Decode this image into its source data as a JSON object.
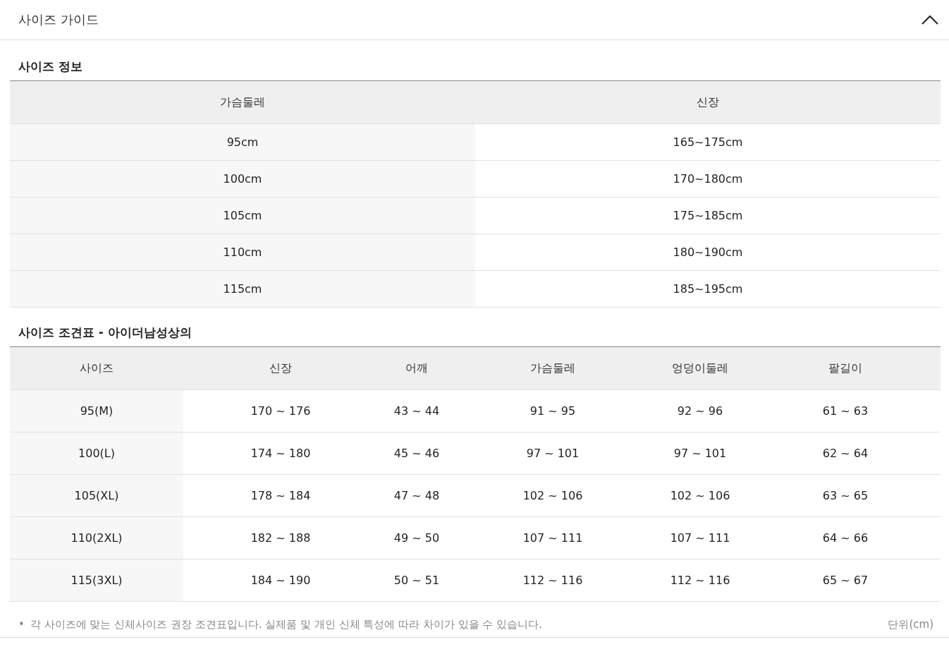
{
  "header": {
    "title": "사이즈 가이드",
    "expanded": true
  },
  "size_info": {
    "title": "사이즈 정보",
    "columns": [
      "가슴둘레",
      "신장"
    ],
    "rows": [
      [
        "95cm",
        "165~175cm"
      ],
      [
        "100cm",
        "170~180cm"
      ],
      [
        "105cm",
        "175~185cm"
      ],
      [
        "110cm",
        "180~190cm"
      ],
      [
        "115cm",
        "185~195cm"
      ]
    ]
  },
  "size_chart": {
    "title": "사이즈 조견표 - 아이더남성상의",
    "columns": [
      "사이즈",
      "신장",
      "어깨",
      "가슴둘레",
      "엉덩이둘레",
      "팔길이"
    ],
    "rows": [
      [
        "95(M)",
        "170 ~ 176",
        "43 ~ 44",
        "91 ~ 95",
        "92 ~ 96",
        "61 ~ 63"
      ],
      [
        "100(L)",
        "174 ~ 180",
        "45 ~ 46",
        "97 ~ 101",
        "97 ~ 101",
        "62 ~ 64"
      ],
      [
        "105(XL)",
        "178 ~ 184",
        "47 ~ 48",
        "102 ~ 106",
        "102 ~ 106",
        "63 ~ 65"
      ],
      [
        "110(2XL)",
        "182 ~ 188",
        "49 ~ 50",
        "107 ~ 111",
        "107 ~ 111",
        "64 ~ 66"
      ],
      [
        "115(3XL)",
        "184 ~ 190",
        "50 ~ 51",
        "112 ~ 116",
        "112 ~ 116",
        "65 ~ 67"
      ]
    ]
  },
  "footer": {
    "bullet": "•",
    "note": "각 사이즈에 맞는 신체사이즈 권장 조견표입니다. 실제품 및 개인 신체 특성에 따라 차이가 있을 수 있습니다.",
    "unit": "단위(cm)"
  }
}
